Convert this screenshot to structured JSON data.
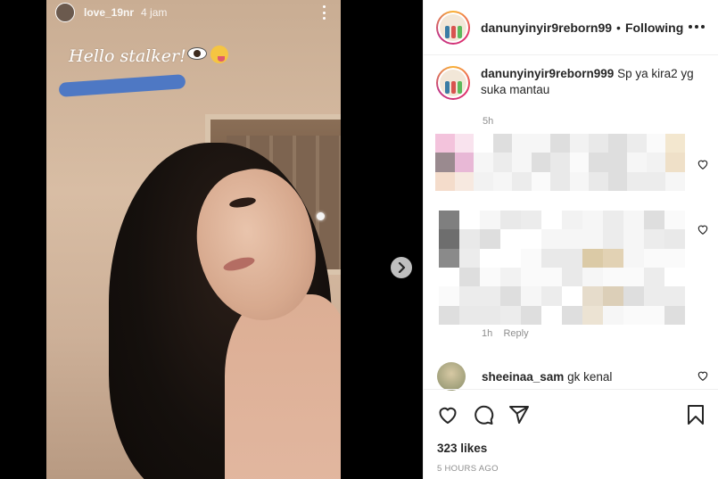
{
  "story": {
    "username": "love_19nr",
    "time": "4 jam",
    "caption": "Hello stalker!"
  },
  "header": {
    "username": "danunyinyir9reborn99",
    "separator": "•",
    "follow_state": "Following"
  },
  "caption": {
    "username": "danunyinyir9reborn999",
    "text": "Sp ya kira2 yg suka mantau",
    "time": "5h"
  },
  "hidden_reply": {
    "time": "1h",
    "reply_label": "Reply"
  },
  "comments": [
    {
      "username": "sheeinaa_sam",
      "text": "gk kenal"
    }
  ],
  "post": {
    "likes": "323 likes",
    "posted": "5 HOURS AGO"
  },
  "colors": {
    "accent_ring": "#e1306c",
    "text": "#262626",
    "muted": "#8e8e8e",
    "scribble": "#3f71c9"
  },
  "icons": [
    "more-icon",
    "heart-icon",
    "comment-icon",
    "share-icon",
    "bookmark-icon",
    "chevron-right-icon"
  ]
}
